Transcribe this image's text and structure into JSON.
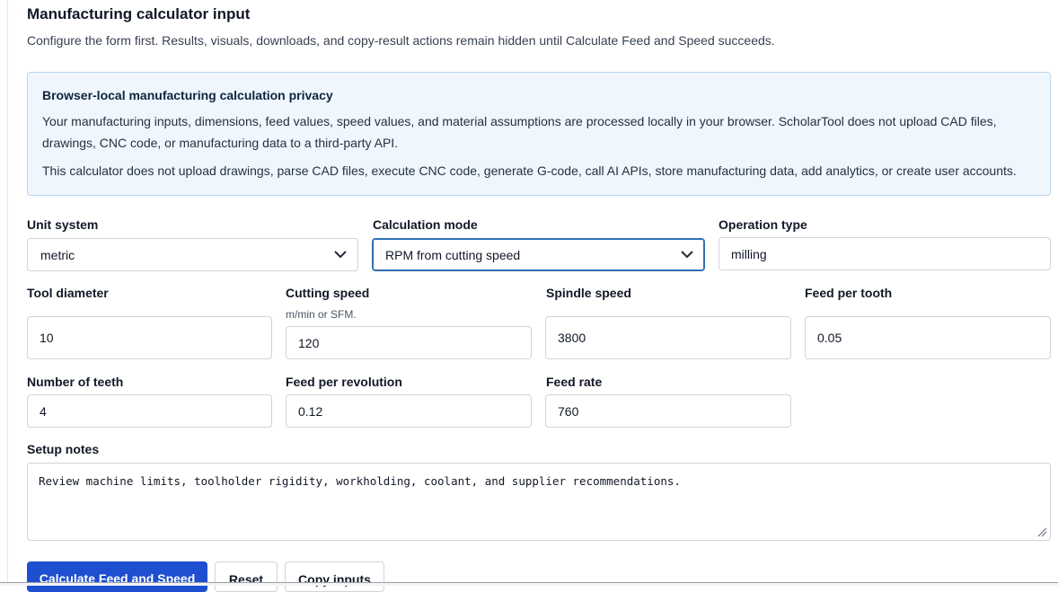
{
  "header": {
    "title": "Manufacturing calculator input",
    "subtitle": "Configure the form first. Results, visuals, downloads, and copy-result actions remain hidden until Calculate Feed and Speed succeeds."
  },
  "privacy": {
    "heading": "Browser-local manufacturing calculation privacy",
    "paragraph1": "Your manufacturing inputs, dimensions, feed values, speed values, and material assumptions are processed locally in your browser. ScholarTool does not upload CAD files, drawings, CNC code, or manufacturing data to a third-party API.",
    "paragraph2": "This calculator does not upload drawings, parse CAD files, execute CNC code, generate G-code, call AI APIs, store manufacturing data, add analytics, or create user accounts."
  },
  "fields": {
    "unit_system": {
      "label": "Unit system",
      "value": "metric"
    },
    "calculation_mode": {
      "label": "Calculation mode",
      "value": "RPM from cutting speed"
    },
    "operation_type": {
      "label": "Operation type",
      "value": "milling"
    },
    "tool_diameter": {
      "label": "Tool diameter",
      "value": "10"
    },
    "cutting_speed": {
      "label": "Cutting speed",
      "hint": "m/min or SFM.",
      "value": "120"
    },
    "spindle_speed": {
      "label": "Spindle speed",
      "value": "3800"
    },
    "feed_per_tooth": {
      "label": "Feed per tooth",
      "value": "0.05"
    },
    "number_of_teeth": {
      "label": "Number of teeth",
      "value": "4"
    },
    "feed_per_revolution": {
      "label": "Feed per revolution",
      "value": "0.12"
    },
    "feed_rate": {
      "label": "Feed rate",
      "value": "760"
    },
    "setup_notes": {
      "label": "Setup notes",
      "value": "Review machine limits, toolholder rigidity, workholding, coolant, and supplier recommendations."
    }
  },
  "actions": {
    "calculate": "Calculate Feed and Speed",
    "reset": "Reset",
    "copy_inputs": "Copy inputs"
  },
  "colors": {
    "primary": "#1e4fd0",
    "notice_bg": "#eff6fd",
    "notice_border": "#bcd7f0",
    "focus": "#2f6fb5"
  }
}
